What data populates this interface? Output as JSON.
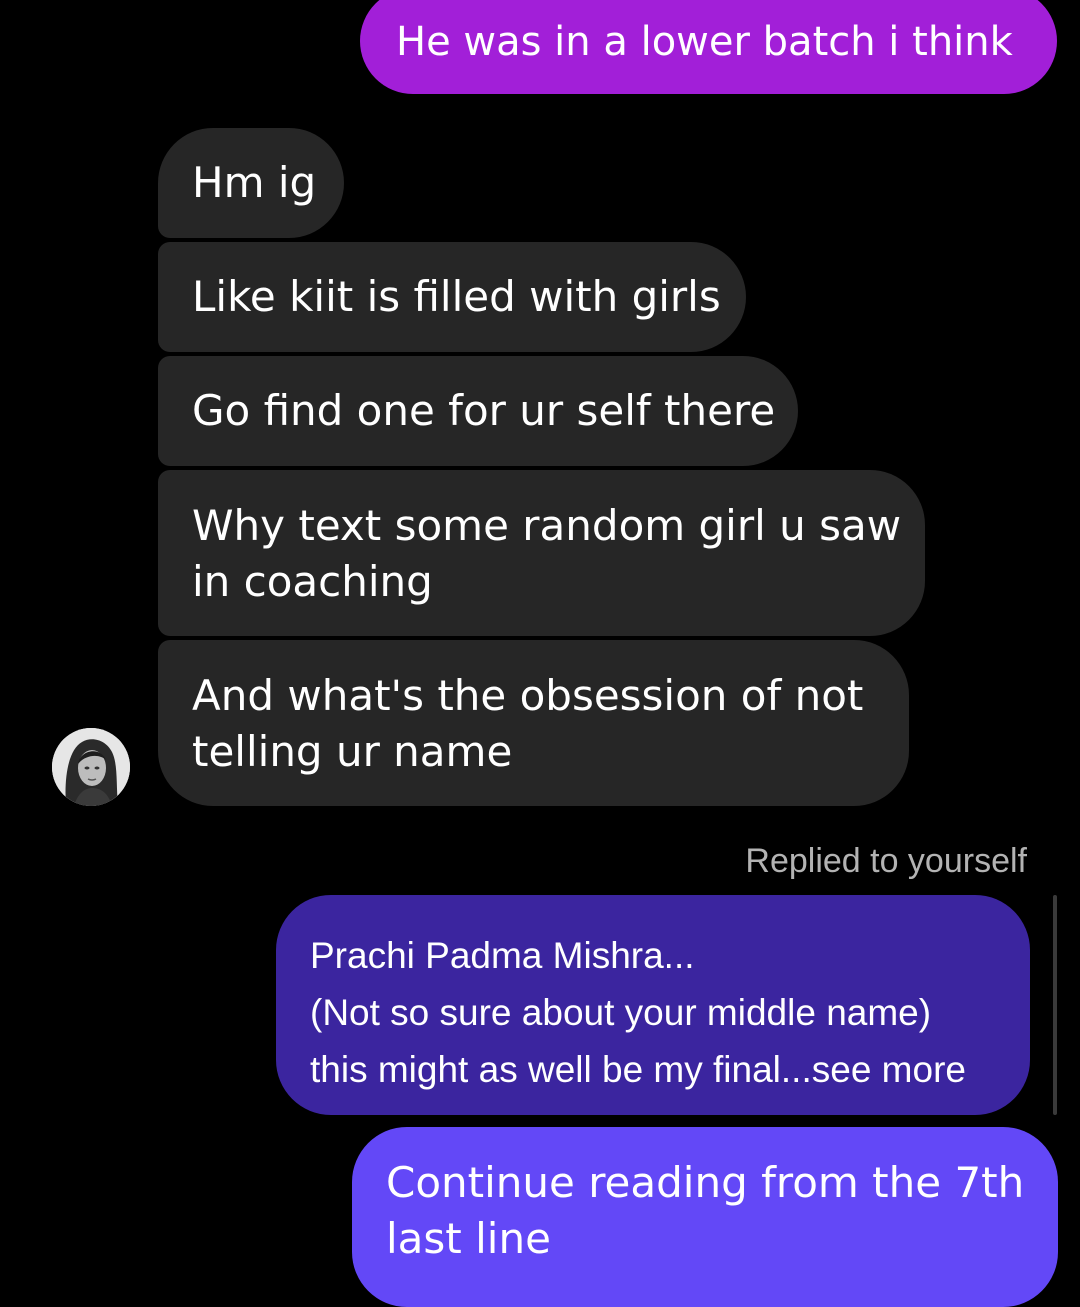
{
  "messages": [
    {
      "text": "He was in a lower batch i think"
    },
    {
      "text": "Hm ig"
    },
    {
      "text": "Like kiit is filled with girls"
    },
    {
      "text": "Go find one for ur self there"
    },
    {
      "line1": "Why text some random girl u saw",
      "line2": "in coaching"
    },
    {
      "line1": "And what's the obsession of not",
      "line2": "telling ur name"
    }
  ],
  "reply": {
    "label": "Replied to yourself",
    "quote_line1": "Prachi Padma Mishra...",
    "quote_line2": "(Not so sure about your middle name)",
    "quote_line3": "this might as well be my final...see more",
    "line1": "Continue reading from the 7th",
    "line2": "last line"
  },
  "colors": {
    "sent_top": "#a21fd8",
    "received": "#262626",
    "quoted": "#3b259f",
    "sent_bottom": "#6348f7"
  },
  "icons": {
    "sender_avatar": "profile-photo-avatar"
  }
}
